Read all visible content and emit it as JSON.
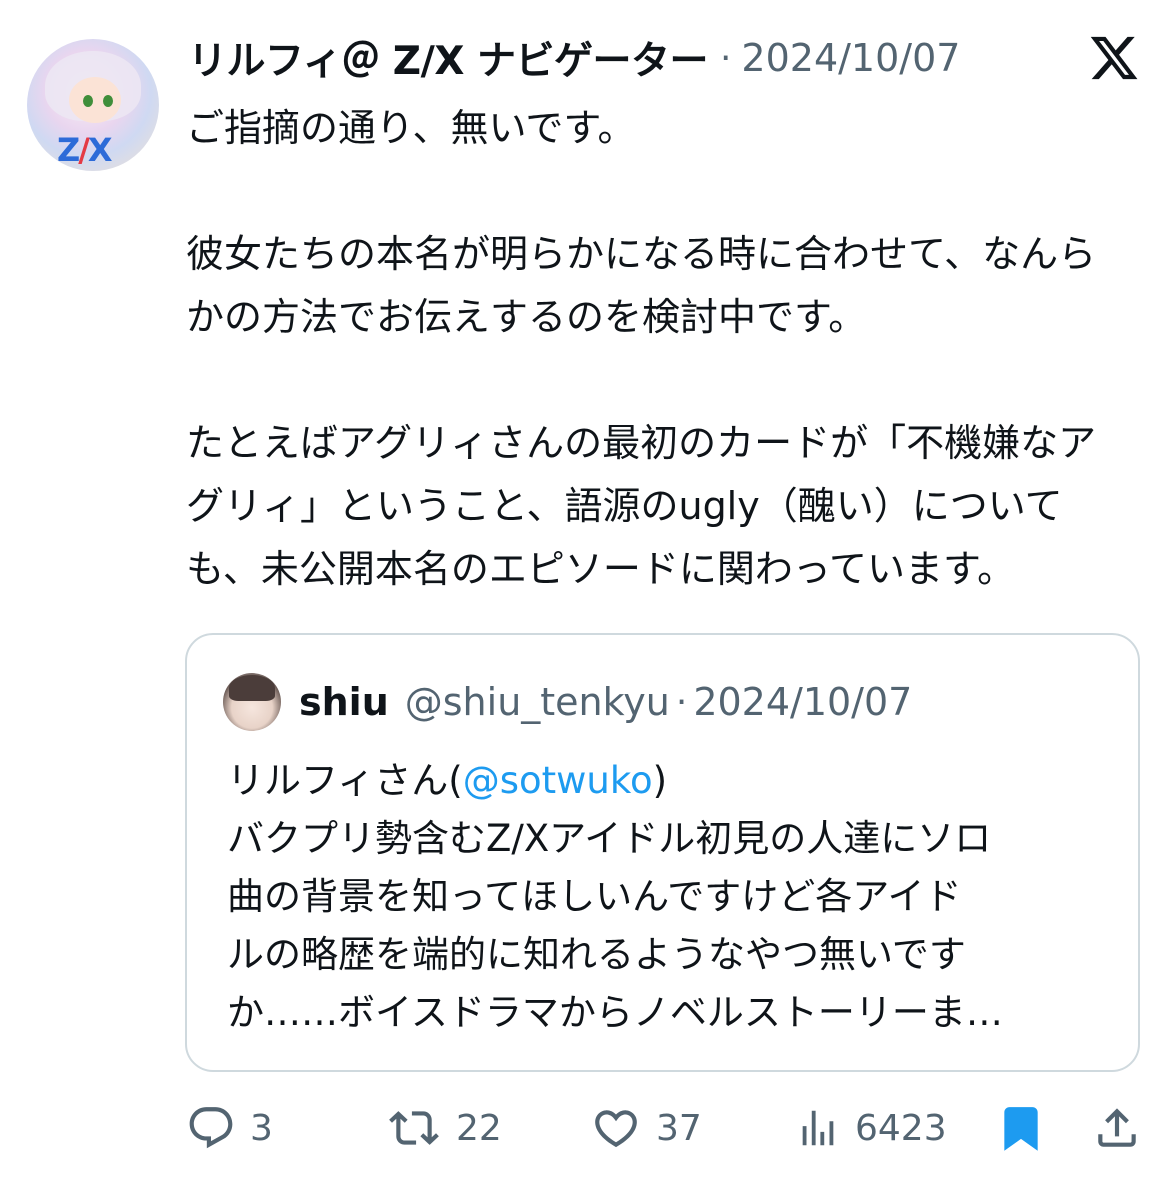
{
  "tweet": {
    "display_name": "リルフィ＠ Z/X ナビゲーター",
    "separator": "·",
    "date": "2024/10/07",
    "paragraphs": [
      "ご指摘の通り、無いです。",
      "彼女たちの本名が明らかになる時に合わせて、なんらかの方法でお伝えするのを検討中です。",
      "たとえばアグリィさんの最初のカードが「不機嫌なアグリィ」ということ、語源のugly（醜い）についても、未公開本名のエピソードに関わっています。"
    ],
    "avatar_logo": "Z/X"
  },
  "quote": {
    "name": "shiu",
    "handle": "@shiu_tenkyu",
    "separator": "·",
    "date": "2024/10/07",
    "line1_prefix": "リルフィさん(",
    "mention": "@sotwuko",
    "line1_suffix": ")",
    "lines": [
      "バクプリ勢含むZ/Xアイドル初見の人達にソロ",
      "曲の背景を知ってほしいんですけど各アイド",
      "ルの略歴を端的に知れるようなやつ無いです",
      "か……ボイスドラマからノベルストーリーま…"
    ]
  },
  "actions": {
    "replies": "3",
    "retweets": "22",
    "likes": "37",
    "views": "6423"
  },
  "colors": {
    "text": "#0f1419",
    "secondary": "#536471",
    "link": "#1d9bf0",
    "bookmark": "#1d9bf0",
    "border": "#cfd9de"
  },
  "icons": [
    "x-logo-icon",
    "reply-icon",
    "retweet-icon",
    "like-icon",
    "views-icon",
    "bookmark-icon",
    "share-icon"
  ]
}
